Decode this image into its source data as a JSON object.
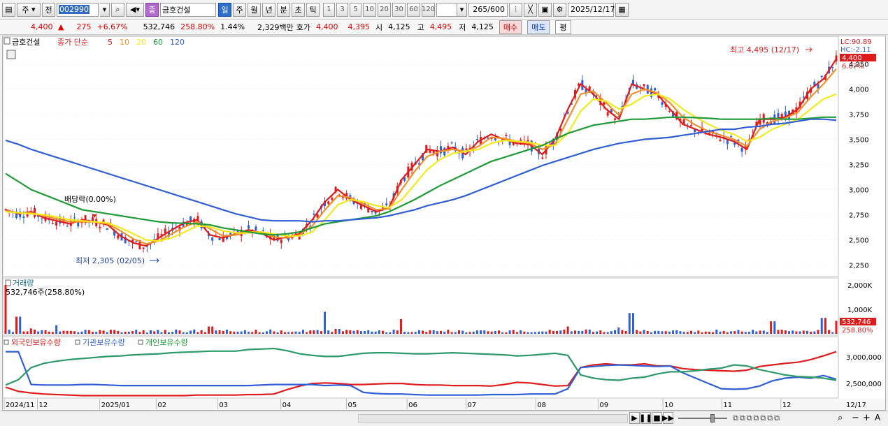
{
  "toolbar": {
    "period_select": "주",
    "prev_label": "전",
    "stock_code": "002990",
    "stock_name": "금호건설",
    "badge": "종",
    "intervals": [
      "일",
      "주",
      "월",
      "년",
      "분",
      "초",
      "틱"
    ],
    "active_interval": "일",
    "counts": [
      "1",
      "3",
      "5",
      "10",
      "20",
      "30",
      "60",
      "120"
    ],
    "range_value": "265",
    "range_total": "/600",
    "date": "2025/12/17"
  },
  "info": {
    "price": "4,400",
    "change": "275",
    "change_pct": "+6.67%",
    "volume": "532,746",
    "volume_ratio": "258.80%",
    "turnover": "1.44%",
    "amount": "2,329백만",
    "quote_label": "호가",
    "ask": "4,400",
    "bid": "4,395",
    "open_label": "시",
    "open": "4,125",
    "high_label": "고",
    "high": "4,495",
    "low_label": "저",
    "low": "4,125",
    "buy_label": "매수",
    "sell_label": "매도",
    "eval_label": "평"
  },
  "legend": {
    "name": "금호건설",
    "series_label": "종가 단순",
    "ma": [
      {
        "label": "5",
        "color": "#e01b1b"
      },
      {
        "label": "10",
        "color": "#f0902a"
      },
      {
        "label": "20",
        "color": "#f2ea1c"
      },
      {
        "label": "60",
        "color": "#1e9a36"
      },
      {
        "label": "120",
        "color": "#2f5fd6"
      }
    ]
  },
  "chart_data": [
    {
      "type": "line",
      "title": "금호건설",
      "y_ticks": [
        "4,250",
        "4,000",
        "3,750",
        "3,500",
        "3,250",
        "3,000",
        "2,750",
        "2,500",
        "2,250"
      ],
      "ylim": [
        2150,
        4510
      ],
      "x_tick_labels": [
        "2024/11",
        "12",
        "2025/01",
        "02",
        "03",
        "04",
        "05",
        "06",
        "07",
        "08",
        "09",
        "10",
        "11",
        "12",
        "12/17"
      ],
      "series": [
        {
          "name": "5",
          "values": [
            2800,
            2760,
            2780,
            2720,
            2690,
            2660,
            2700,
            2680,
            2650,
            2540,
            2470,
            2440,
            2520,
            2600,
            2670,
            2700,
            2550,
            2520,
            2560,
            2600,
            2570,
            2500,
            2530,
            2560,
            2700,
            2880,
            3000,
            2900,
            2840,
            2780,
            2820,
            3100,
            3250,
            3400,
            3380,
            3420,
            3350,
            3480,
            3550,
            3500,
            3460,
            3450,
            3350,
            3500,
            3800,
            4050,
            3950,
            3800,
            3700,
            4050,
            4000,
            3950,
            3800,
            3650,
            3600,
            3550,
            3520,
            3480,
            3400,
            3700,
            3700,
            3720,
            3800,
            4000,
            4100,
            4300
          ]
        },
        {
          "name": "10",
          "values": [
            2790,
            2770,
            2770,
            2740,
            2710,
            2680,
            2680,
            2680,
            2660,
            2590,
            2510,
            2460,
            2490,
            2560,
            2630,
            2680,
            2610,
            2540,
            2550,
            2580,
            2580,
            2530,
            2520,
            2550,
            2640,
            2800,
            2940,
            2920,
            2860,
            2800,
            2810,
            3000,
            3180,
            3330,
            3380,
            3400,
            3380,
            3430,
            3520,
            3510,
            3480,
            3460,
            3400,
            3450,
            3700,
            3950,
            3980,
            3860,
            3740,
            3950,
            4000,
            3960,
            3860,
            3720,
            3640,
            3580,
            3540,
            3500,
            3430,
            3600,
            3680,
            3710,
            3770,
            3920,
            4050,
            4200
          ]
        },
        {
          "name": "20",
          "values": [
            2780,
            2770,
            2760,
            2750,
            2730,
            2700,
            2690,
            2680,
            2670,
            2620,
            2560,
            2500,
            2490,
            2520,
            2580,
            2640,
            2630,
            2590,
            2570,
            2570,
            2580,
            2560,
            2540,
            2540,
            2580,
            2700,
            2850,
            2900,
            2880,
            2840,
            2820,
            2900,
            3050,
            3200,
            3300,
            3360,
            3380,
            3400,
            3460,
            3490,
            3480,
            3470,
            3440,
            3440,
            3560,
            3780,
            3900,
            3880,
            3800,
            3850,
            3930,
            3950,
            3900,
            3800,
            3720,
            3650,
            3590,
            3550,
            3480,
            3520,
            3600,
            3650,
            3700,
            3800,
            3900,
            3950
          ]
        },
        {
          "name": "60",
          "values": [
            3160,
            3080,
            3000,
            2950,
            2900,
            2850,
            2800,
            2780,
            2760,
            2740,
            2720,
            2700,
            2680,
            2670,
            2665,
            2660,
            2650,
            2620,
            2600,
            2580,
            2560,
            2550,
            2560,
            2580,
            2620,
            2660,
            2680,
            2700,
            2720,
            2740,
            2780,
            2840,
            2900,
            2970,
            3040,
            3100,
            3160,
            3220,
            3280,
            3320,
            3360,
            3400,
            3440,
            3500,
            3560,
            3600,
            3640,
            3660,
            3680,
            3700,
            3700,
            3710,
            3720,
            3720,
            3715,
            3710,
            3700,
            3700,
            3700,
            3700,
            3710,
            3700,
            3700,
            3710,
            3720,
            3720
          ]
        },
        {
          "name": "120",
          "values": [
            3490,
            3450,
            3400,
            3360,
            3320,
            3280,
            3240,
            3200,
            3160,
            3120,
            3080,
            3040,
            3000,
            2960,
            2920,
            2880,
            2840,
            2800,
            2760,
            2730,
            2700,
            2690,
            2690,
            2690,
            2680,
            2690,
            2690,
            2700,
            2710,
            2720,
            2740,
            2770,
            2800,
            2840,
            2870,
            2900,
            2940,
            2990,
            3040,
            3090,
            3140,
            3190,
            3240,
            3280,
            3320,
            3360,
            3400,
            3430,
            3460,
            3480,
            3500,
            3510,
            3520,
            3540,
            3560,
            3580,
            3600,
            3600,
            3620,
            3630,
            3650,
            3660,
            3680,
            3700,
            3700,
            3690
          ]
        }
      ],
      "annotations": {
        "high": "최고 4,495 (12/17)",
        "low": "최저 2,305 (02/05)",
        "dividend": "배당락(0.00%)",
        "lc": "LC:90.89",
        "hc": "HC:-2.11",
        "last_price": "4,400",
        "last_pct": "6.67%"
      }
    },
    {
      "type": "bar",
      "title": "거래량",
      "subtitle": "532,746주(258.80%)",
      "y_ticks": [
        "2,000K",
        "1,000K"
      ],
      "ylim": [
        0,
        2200
      ],
      "series": [
        {
          "name": "거래량",
          "values": [
            2000,
            700,
            220,
            150,
            350,
            120,
            90,
            80,
            70,
            60,
            110,
            50,
            160,
            80,
            60,
            70,
            300,
            120,
            90,
            80,
            60,
            100,
            70,
            80,
            140,
            900,
            200,
            150,
            110,
            90,
            60,
            600,
            80,
            80,
            120,
            70,
            60,
            140,
            90,
            60,
            70,
            65,
            100,
            120,
            300,
            120,
            80,
            70,
            260,
            850,
            160,
            120,
            90,
            80,
            70,
            80,
            90,
            110,
            80,
            130,
            510,
            140,
            100,
            90,
            650,
            532
          ]
        }
      ],
      "last_value": "532,746",
      "last_pct": "258.80%"
    },
    {
      "type": "line",
      "title": "투자자별 보유수량",
      "y_ticks": [
        "3,000,000",
        "2,500,000"
      ],
      "ylim": [
        2250000,
        3200000
      ],
      "series": [
        {
          "name": "외국인보유수량",
          "values": [
            2430000,
            2350000,
            2320000,
            2300000,
            2290000,
            2280000,
            2270000,
            2270000,
            2270000,
            2270000,
            2270000,
            2270000,
            2270000,
            2270000,
            2270000,
            2280000,
            2280000,
            2280000,
            2280000,
            2290000,
            2290000,
            2300000,
            2380000,
            2450000,
            2500000,
            2510000,
            2500000,
            2480000,
            2480000,
            2490000,
            2500000,
            2500000,
            2480000,
            2470000,
            2470000,
            2460000,
            2460000,
            2460000,
            2450000,
            2480000,
            2520000,
            2510000,
            2480000,
            2450000,
            2460000,
            2800000,
            2850000,
            2870000,
            2850000,
            2850000,
            2870000,
            2830000,
            2830000,
            2780000,
            2760000,
            2750000,
            2740000,
            2730000,
            2750000,
            2820000,
            2850000,
            2880000,
            2900000,
            2950000,
            3020000,
            3100000
          ]
        },
        {
          "name": "기관보유수량",
          "values": [
            3100000,
            3100000,
            2480000,
            2470000,
            2470000,
            2470000,
            2480000,
            2480000,
            2470000,
            2460000,
            2460000,
            2460000,
            2460000,
            2460000,
            2460000,
            2460000,
            2460000,
            2460000,
            2460000,
            2460000,
            2470000,
            2480000,
            2480000,
            2480000,
            2480000,
            2460000,
            2470000,
            2460000,
            2330000,
            2310000,
            2300000,
            2300000,
            2290000,
            2280000,
            2280000,
            2280000,
            2280000,
            2280000,
            2290000,
            2290000,
            2290000,
            2300000,
            2300000,
            2300000,
            2400000,
            2800000,
            2820000,
            2840000,
            2850000,
            2840000,
            2830000,
            2820000,
            2830000,
            2700000,
            2600000,
            2500000,
            2400000,
            2390000,
            2400000,
            2450000,
            2550000,
            2600000,
            2620000,
            2600000,
            2650000,
            2580000
          ]
        },
        {
          "name": "개인보유수량",
          "values": [
            2470000,
            2570000,
            2800000,
            2880000,
            2920000,
            2950000,
            2970000,
            2990000,
            3010000,
            3020000,
            3040000,
            3050000,
            3060000,
            3080000,
            3090000,
            3100000,
            3110000,
            3110000,
            3110000,
            3140000,
            3150000,
            3160000,
            3120000,
            3060000,
            3030000,
            3010000,
            3010000,
            3040000,
            3070000,
            3080000,
            3080000,
            3070000,
            3060000,
            3060000,
            3070000,
            3080000,
            3070000,
            3060000,
            3050000,
            3040000,
            3020000,
            3030000,
            3050000,
            3070000,
            3030000,
            2660000,
            2600000,
            2570000,
            2560000,
            2600000,
            2620000,
            2680000,
            2720000,
            2720000,
            2740000,
            2770000,
            2790000,
            2850000,
            2830000,
            2760000,
            2710000,
            2660000,
            2630000,
            2620000,
            2600000,
            2560000
          ]
        }
      ]
    }
  ],
  "volume_label": "거래량",
  "volume_value": "532,746주(258.80%)",
  "investor_legend": [
    "외국인보유수량",
    "기관보유수량",
    "개인보유수량"
  ]
}
